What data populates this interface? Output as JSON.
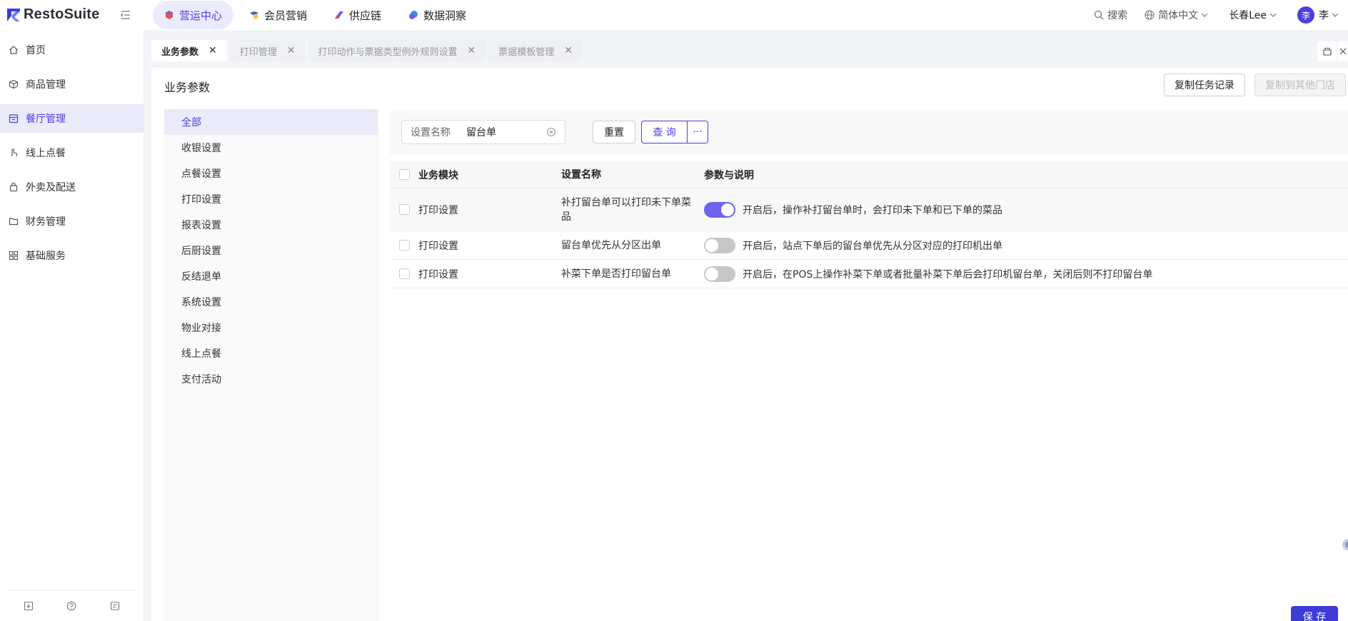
{
  "app": {
    "logo_text": "RestoSuite"
  },
  "topnav": [
    {
      "label": "营运中心",
      "active": true,
      "icon": "shield-cube-icon"
    },
    {
      "label": "会员营销",
      "active": false,
      "icon": "member-icon"
    },
    {
      "label": "供应链",
      "active": false,
      "icon": "supply-chain-icon"
    },
    {
      "label": "数据洞察",
      "active": false,
      "icon": "data-insight-icon"
    }
  ],
  "topright": {
    "search_label": "搜索",
    "language_label": "简体中文",
    "store_label": "长春Lee",
    "avatar_letter": "李",
    "user_label": "李"
  },
  "sidebar": {
    "items": [
      {
        "label": "首页",
        "icon": "home-icon",
        "active": false
      },
      {
        "label": "商品管理",
        "icon": "box-icon",
        "active": false
      },
      {
        "label": "餐厅管理",
        "icon": "store-icon",
        "active": true
      },
      {
        "label": "线上点餐",
        "icon": "hand-tap-icon",
        "active": false
      },
      {
        "label": "外卖及配送",
        "icon": "bag-icon",
        "active": false
      },
      {
        "label": "财务管理",
        "icon": "folder-icon",
        "active": false
      },
      {
        "label": "基础服务",
        "icon": "grid-icon",
        "active": false
      }
    ]
  },
  "page_tabs": [
    {
      "label": "业务参数",
      "active": true
    },
    {
      "label": "打印管理",
      "active": false
    },
    {
      "label": "打印动作与票据类型例外规则设置",
      "active": false
    },
    {
      "label": "票据模板管理",
      "active": false
    }
  ],
  "main": {
    "title": "业务参数",
    "copy_records_label": "复制任务记录",
    "copy_to_store_label": "复制到其他门店",
    "save_label": "保 存"
  },
  "categories": [
    {
      "label": "全部",
      "active": true
    },
    {
      "label": "收银设置",
      "active": false
    },
    {
      "label": "点餐设置",
      "active": false
    },
    {
      "label": "打印设置",
      "active": false
    },
    {
      "label": "报表设置",
      "active": false
    },
    {
      "label": "后厨设置",
      "active": false
    },
    {
      "label": "反结退单",
      "active": false
    },
    {
      "label": "系统设置",
      "active": false
    },
    {
      "label": "物业对接",
      "active": false
    },
    {
      "label": "线上点餐",
      "active": false
    },
    {
      "label": "支付活动",
      "active": false
    }
  ],
  "filter": {
    "label": "设置名称",
    "value": "留台单",
    "reset_label": "重置",
    "query_label": "查 询",
    "more_label": "···"
  },
  "table": {
    "headers": {
      "module": "业务模块",
      "name": "设置名称",
      "desc": "参数与说明"
    },
    "rows": [
      {
        "module": "打印设置",
        "name": "补打留台单可以打印未下单菜品",
        "enabled": true,
        "desc": "开启后，操作补打留台单时，会打印未下单和已下单的菜品"
      },
      {
        "module": "打印设置",
        "name": "留台单优先从分区出单",
        "enabled": false,
        "desc": "开启后，站点下单后的留台单优先从分区对应的打印机出单"
      },
      {
        "module": "打印设置",
        "name": "补菜下单是否打印留台单",
        "enabled": false,
        "desc": "开启后，在POS上操作补菜下单或者批量补菜下单后会打印机留台单，关闭后则不打印留台单"
      }
    ]
  },
  "colors": {
    "accent": "#4a3fe0",
    "switch_on": "#6c63f0",
    "save": "#3d3ad6"
  }
}
